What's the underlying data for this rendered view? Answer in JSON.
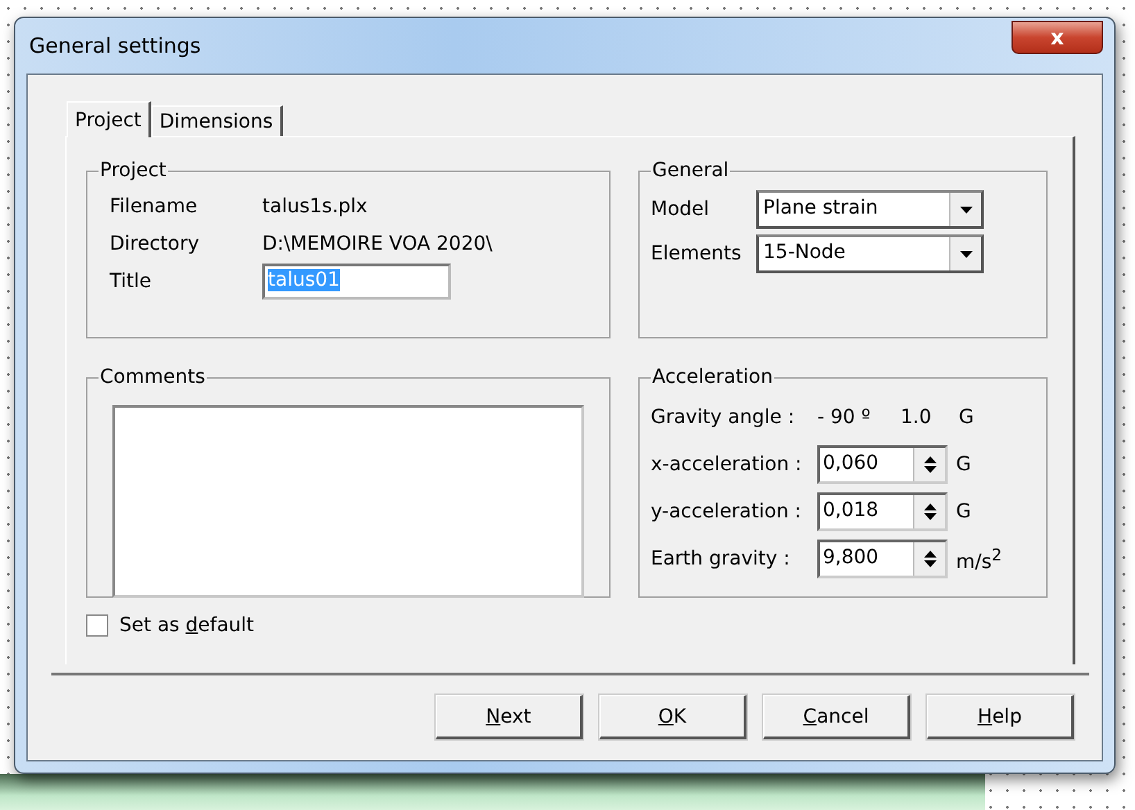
{
  "window": {
    "title": "General settings",
    "close": "x"
  },
  "tabs": [
    {
      "label": "Project",
      "selected": true
    },
    {
      "label": "Dimensions",
      "selected": false
    }
  ],
  "project": {
    "legend": "Project",
    "rows": [
      {
        "kind": "text",
        "label": "Filename",
        "value": "talus1s.plx"
      },
      {
        "kind": "text",
        "label": "Directory",
        "value": "D:\\MEMOIRE VOA 2020\\"
      },
      {
        "kind": "input",
        "label": "Title",
        "value": "talus01",
        "selected": true
      }
    ]
  },
  "general": {
    "legend": "General",
    "rows": [
      {
        "label": "Model",
        "value": "Plane strain"
      },
      {
        "label": "Elements",
        "value": "15-Node"
      }
    ]
  },
  "comments": {
    "legend": "Comments"
  },
  "acceleration": {
    "legend": "Acceleration",
    "gravity": {
      "label": "Gravity angle :",
      "angle": "- 90 º",
      "value": "1.0",
      "unit": "G"
    },
    "rows": [
      {
        "label": "x-acceleration :",
        "value": "0,060",
        "unit": "G"
      },
      {
        "label": "y-acceleration :",
        "value": "0,018",
        "unit": "G"
      },
      {
        "label": "Earth gravity :",
        "value": "9,800",
        "unit": "m/s$^{2}$"
      }
    ]
  },
  "set_default": {
    "before": "Set as ",
    "key": "d",
    "rest": "efault",
    "checked": false
  },
  "buttons": [
    {
      "key": "N",
      "rest": "ext"
    },
    {
      "key": "O",
      "rest": "K"
    },
    {
      "key": "C",
      "rest": "ancel"
    },
    {
      "key": "H",
      "rest": "elp"
    }
  ]
}
